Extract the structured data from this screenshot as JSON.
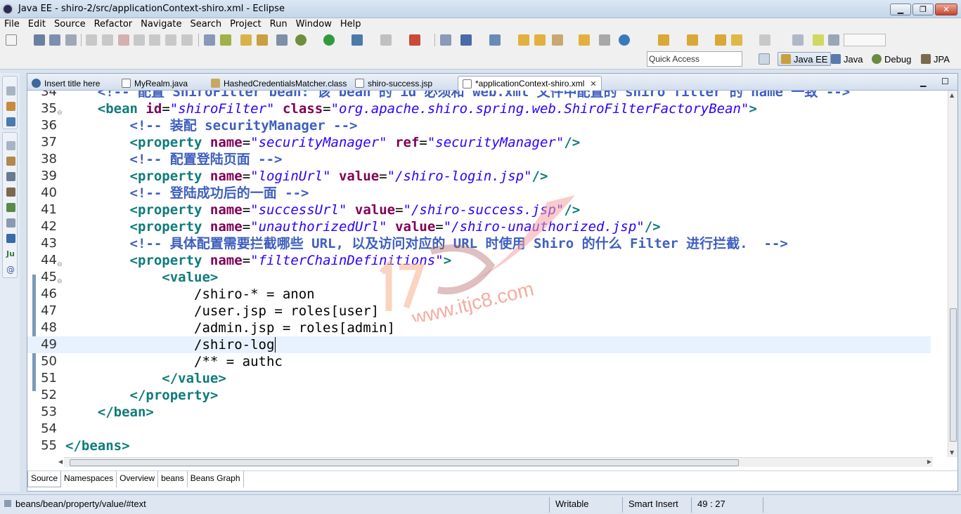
{
  "window": {
    "title": "Java EE - shiro-2/src/applicationContext-shiro.xml - Eclipse"
  },
  "menu": [
    "File",
    "Edit",
    "Source",
    "Refactor",
    "Navigate",
    "Search",
    "Project",
    "Run",
    "Window",
    "Help"
  ],
  "quick_access": {
    "placeholder": "Quick Access"
  },
  "perspectives": [
    {
      "label": "Java EE",
      "active": true
    },
    {
      "label": "Java",
      "active": false
    },
    {
      "label": "Debug",
      "active": false
    },
    {
      "label": "JPA",
      "active": false
    }
  ],
  "tabs": [
    {
      "label": "Insert title here",
      "icon": "globe-icon"
    },
    {
      "label": "MyRealm.java",
      "icon": "java-file-icon"
    },
    {
      "label": "HashedCredentialsMatcher.class",
      "icon": "class-file-icon"
    },
    {
      "label": "shiro-success.jsp",
      "icon": "jsp-file-icon"
    },
    {
      "label": "*applicationContext-shiro.xml",
      "icon": "xml-file-icon",
      "active": true
    }
  ],
  "code_lines": [
    {
      "n": "34",
      "tokens": [
        [
          "cmt",
          "    <!-- 配置 ShiroFilter bean: 该 bean 的 id 必须和 web.xml 文件中配置的 shiro filter 的 name 一致 -->"
        ]
      ]
    },
    {
      "n": "35",
      "fold": true,
      "tokens": [
        [
          "text",
          "    "
        ],
        [
          "tag",
          "<bean"
        ],
        [
          "text",
          " "
        ],
        [
          "attr",
          "id"
        ],
        [
          "text",
          "="
        ],
        [
          "val",
          "\"shiroFilter\""
        ],
        [
          "text",
          " "
        ],
        [
          "attr",
          "class"
        ],
        [
          "text",
          "="
        ],
        [
          "val",
          "\"org.apache.shiro.spring.web.ShiroFilterFactoryBean\""
        ],
        [
          "tag",
          ">"
        ]
      ]
    },
    {
      "n": "36",
      "tokens": [
        [
          "cmt",
          "        <!-- 装配 securityManager -->"
        ]
      ]
    },
    {
      "n": "37",
      "tokens": [
        [
          "text",
          "        "
        ],
        [
          "tag",
          "<property"
        ],
        [
          "text",
          " "
        ],
        [
          "attr",
          "name"
        ],
        [
          "text",
          "="
        ],
        [
          "val",
          "\"securityManager\""
        ],
        [
          "text",
          " "
        ],
        [
          "attr",
          "ref"
        ],
        [
          "text",
          "="
        ],
        [
          "val",
          "\"securityManager\""
        ],
        [
          "tag",
          "/>"
        ]
      ]
    },
    {
      "n": "38",
      "tokens": [
        [
          "cmt",
          "        <!-- 配置登陆页面 -->"
        ]
      ]
    },
    {
      "n": "39",
      "tokens": [
        [
          "text",
          "        "
        ],
        [
          "tag",
          "<property"
        ],
        [
          "text",
          " "
        ],
        [
          "attr",
          "name"
        ],
        [
          "text",
          "="
        ],
        [
          "val",
          "\"loginUrl\""
        ],
        [
          "text",
          " "
        ],
        [
          "attr",
          "value"
        ],
        [
          "text",
          "="
        ],
        [
          "val",
          "\"/shiro-login.jsp\""
        ],
        [
          "tag",
          "/>"
        ]
      ]
    },
    {
      "n": "40",
      "tokens": [
        [
          "cmt",
          "        <!-- 登陆成功后的一面 -->"
        ]
      ]
    },
    {
      "n": "41",
      "tokens": [
        [
          "text",
          "        "
        ],
        [
          "tag",
          "<property"
        ],
        [
          "text",
          " "
        ],
        [
          "attr",
          "name"
        ],
        [
          "text",
          "="
        ],
        [
          "val",
          "\"successUrl\""
        ],
        [
          "text",
          " "
        ],
        [
          "attr",
          "value"
        ],
        [
          "text",
          "="
        ],
        [
          "val",
          "\"/shiro-success.jsp\""
        ],
        [
          "tag",
          "/>"
        ]
      ]
    },
    {
      "n": "42",
      "tokens": [
        [
          "text",
          "        "
        ],
        [
          "tag",
          "<property"
        ],
        [
          "text",
          " "
        ],
        [
          "attr",
          "name"
        ],
        [
          "text",
          "="
        ],
        [
          "val",
          "\"unauthorizedUrl\""
        ],
        [
          "text",
          " "
        ],
        [
          "attr",
          "value"
        ],
        [
          "text",
          "="
        ],
        [
          "val",
          "\"/shiro-unauthorized.jsp\""
        ],
        [
          "tag",
          "/>"
        ]
      ]
    },
    {
      "n": "43",
      "tokens": [
        [
          "cmt",
          "        <!-- 具体配置需要拦截哪些 URL, 以及访问对应的 URL 时使用 Shiro 的什么 Filter 进行拦截.  -->"
        ]
      ]
    },
    {
      "n": "44",
      "fold": true,
      "tokens": [
        [
          "text",
          "        "
        ],
        [
          "tag",
          "<property"
        ],
        [
          "text",
          " "
        ],
        [
          "attr",
          "name"
        ],
        [
          "text",
          "="
        ],
        [
          "val",
          "\"filterChainDefinitions\""
        ],
        [
          "tag",
          ">"
        ]
      ]
    },
    {
      "n": "45",
      "fold": true,
      "tokens": [
        [
          "text",
          "            "
        ],
        [
          "tag",
          "<value>"
        ]
      ]
    },
    {
      "n": "46",
      "tokens": [
        [
          "text",
          "                /shiro-* = anon"
        ]
      ]
    },
    {
      "n": "47",
      "tokens": [
        [
          "text",
          "                /user.jsp = roles[user]"
        ]
      ]
    },
    {
      "n": "48",
      "tokens": [
        [
          "text",
          "                /admin.jsp = roles[admin]"
        ]
      ]
    },
    {
      "n": "49",
      "current": true,
      "tokens": [
        [
          "text",
          "                /shiro-log"
        ]
      ]
    },
    {
      "n": "50",
      "tokens": [
        [
          "text",
          "                /** = authc"
        ]
      ]
    },
    {
      "n": "51",
      "tokens": [
        [
          "text",
          "            "
        ],
        [
          "tag",
          "</value>"
        ]
      ]
    },
    {
      "n": "52",
      "tokens": [
        [
          "text",
          "        "
        ],
        [
          "tag",
          "</property>"
        ]
      ]
    },
    {
      "n": "53",
      "tokens": [
        [
          "text",
          "    "
        ],
        [
          "tag",
          "</bean>"
        ]
      ]
    },
    {
      "n": "54",
      "tokens": [
        [
          "text",
          ""
        ]
      ]
    },
    {
      "n": "55",
      "tokens": [
        [
          "tag",
          "</beans>"
        ]
      ]
    }
  ],
  "bottom_tabs": [
    "Source",
    "Namespaces",
    "Overview",
    "beans",
    "Beans Graph"
  ],
  "status": {
    "path": "beans/bean/property/value/#text",
    "mode": "Writable",
    "insert": "Smart Insert",
    "position": "49 : 27"
  },
  "watermark": {
    "url": "www.itjc8.com"
  }
}
